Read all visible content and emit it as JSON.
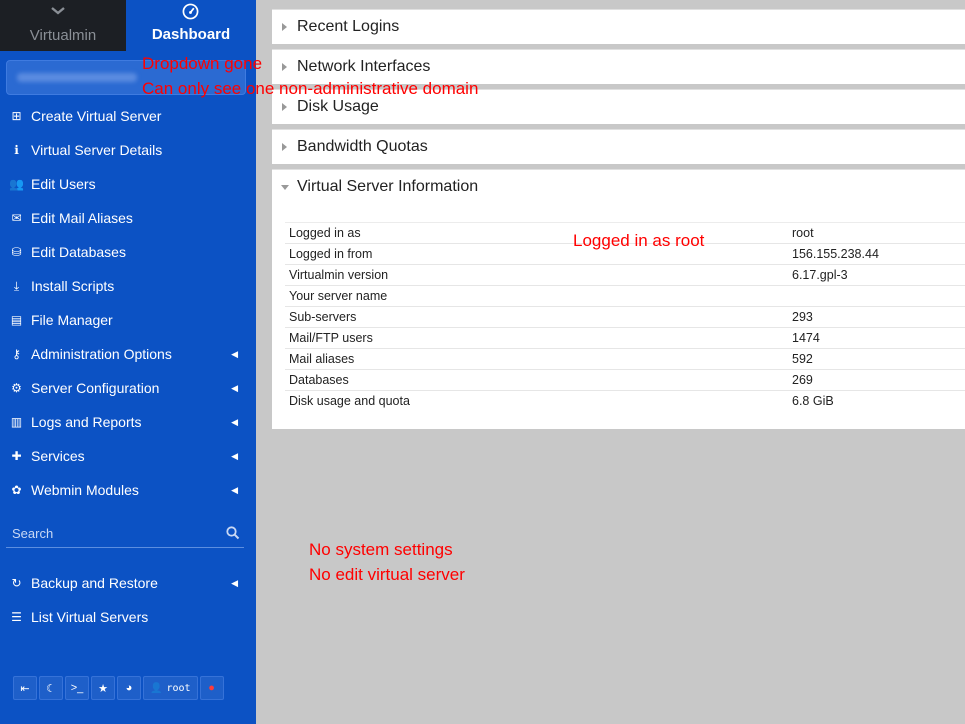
{
  "sidebar": {
    "top_tabs": {
      "virtualmin": "Virtualmin",
      "dashboard": "Dashboard"
    },
    "menu": [
      {
        "label": "Create Virtual Server",
        "icon": "server-plus-icon",
        "caret": false
      },
      {
        "label": "Virtual Server Details",
        "icon": "info-circle-icon",
        "caret": false
      },
      {
        "label": "Edit Users",
        "icon": "users-icon",
        "caret": false
      },
      {
        "label": "Edit Mail Aliases",
        "icon": "mail-aliases-icon",
        "caret": false
      },
      {
        "label": "Edit Databases",
        "icon": "database-icon",
        "caret": false
      },
      {
        "label": "Install Scripts",
        "icon": "download-box-icon",
        "caret": false
      },
      {
        "label": "File Manager",
        "icon": "folder-icon",
        "caret": false
      },
      {
        "label": "Administration Options",
        "icon": "key-icon",
        "caret": true
      },
      {
        "label": "Server Configuration",
        "icon": "cogs-icon",
        "caret": true
      },
      {
        "label": "Logs and Reports",
        "icon": "file-text-icon",
        "caret": true
      },
      {
        "label": "Services",
        "icon": "puzzle-icon",
        "caret": true
      },
      {
        "label": "Webmin Modules",
        "icon": "modules-icon",
        "caret": true
      }
    ],
    "search": {
      "placeholder": "Search"
    },
    "menu2": [
      {
        "label": "Backup and Restore",
        "icon": "restore-icon",
        "caret": true
      },
      {
        "label": "List Virtual Servers",
        "icon": "list-icon",
        "caret": false
      }
    ],
    "footer": {
      "user": "root"
    }
  },
  "panels": {
    "recent_logins": "Recent Logins",
    "network_interfaces": "Network Interfaces",
    "disk_usage": "Disk Usage",
    "bandwidth_quotas": "Bandwidth Quotas",
    "virtual_server_information": "Virtual Server Information"
  },
  "info_table": [
    {
      "k": "Logged in as",
      "v": "root"
    },
    {
      "k": "Logged in from",
      "v": "156.155.238.44"
    },
    {
      "k": "Virtualmin version",
      "v": "6.17.gpl-3"
    },
    {
      "k": "Your server name",
      "v": ""
    },
    {
      "k": "Sub-servers",
      "v": "293"
    },
    {
      "k": "Mail/FTP users",
      "v": "1474"
    },
    {
      "k": "Mail aliases",
      "v": "592"
    },
    {
      "k": "Databases",
      "v": "269"
    },
    {
      "k": "Disk usage and quota",
      "v": "6.8 GiB"
    }
  ],
  "annotations": {
    "dropdown_gone": "Dropdown gone",
    "one_domain": "Can only see one non-administrative domain",
    "logged_root": "Logged in as root",
    "no_system_settings": "No system settings",
    "no_edit_virtual_server": "No edit virtual server"
  },
  "colors": {
    "sidebar": "#0c52c4",
    "annotation": "#ff0000",
    "background": "#c8c8c8"
  }
}
